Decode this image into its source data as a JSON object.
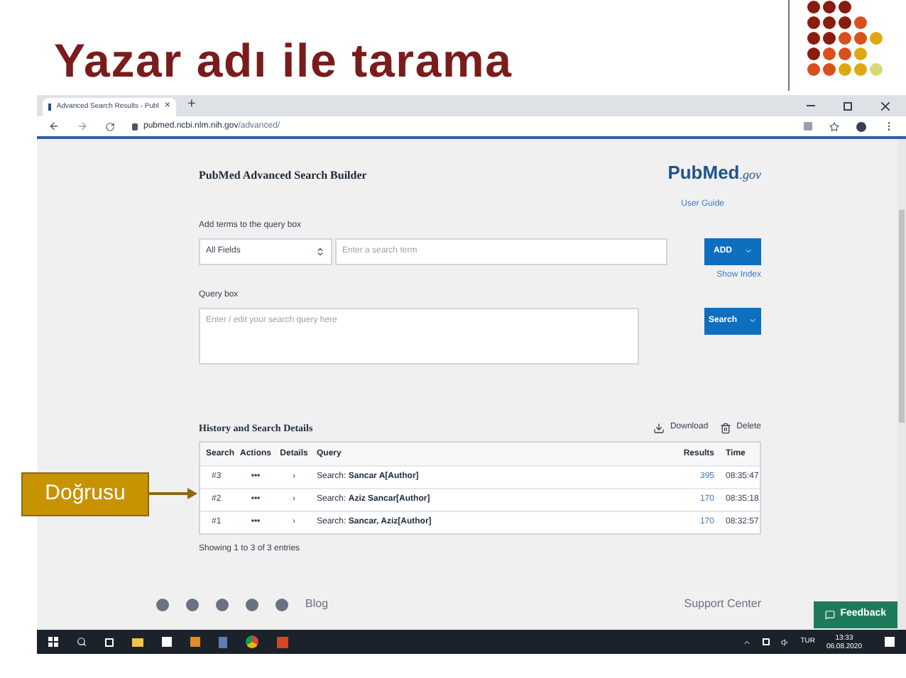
{
  "slide": {
    "title": "Yazar adı ile tarama",
    "callout": "Doğrusu"
  },
  "browser": {
    "tab_title": "Advanced Search Results - Publ",
    "tab_close": "×",
    "new_tab": "+",
    "url_host": "pubmed.ncbi.nlm.nih.gov",
    "url_path": "/advanced/"
  },
  "page": {
    "heading": "PubMed Advanced Search Builder",
    "logo_left": "Pub",
    "logo_right": "Med",
    "logo_suffix": ".gov",
    "user_guide": "User Guide",
    "add_terms_label": "Add terms to the query box",
    "field_select": "All Fields",
    "term_placeholder": "Enter a search term",
    "add_button": "ADD",
    "show_index": "Show Index",
    "query_label": "Query box",
    "query_placeholder": "Enter / edit your search query here",
    "search_button": "Search",
    "history_heading": "History and Search Details",
    "download": "Download",
    "delete": "Delete",
    "columns": [
      "Search",
      "Actions",
      "Details",
      "Query",
      "Results",
      "Time"
    ],
    "rows": [
      {
        "search": "#3",
        "actions": "•••",
        "details": "›",
        "query": "Search: **Sancar A[Author]**",
        "results": "395",
        "time": "08:35:47"
      },
      {
        "search": "#2",
        "actions": "•••",
        "details": "›",
        "query": "Search: **Aziz Sancar[Author]**",
        "results": "170",
        "time": "08:35:18"
      },
      {
        "search": "#1",
        "actions": "•••",
        "details": "›",
        "query": "Search: **Sancar, Aziz[Author]**",
        "results": "170",
        "time": "08:32:57"
      }
    ],
    "showing": "Showing 1 to 3 of 3 entries",
    "footer_blog": "Blog",
    "footer_support": "Support Center",
    "feedback": "Feedback"
  },
  "taskbar": {
    "language": "TUR",
    "time": "13:33",
    "date": "06.08.2020"
  }
}
